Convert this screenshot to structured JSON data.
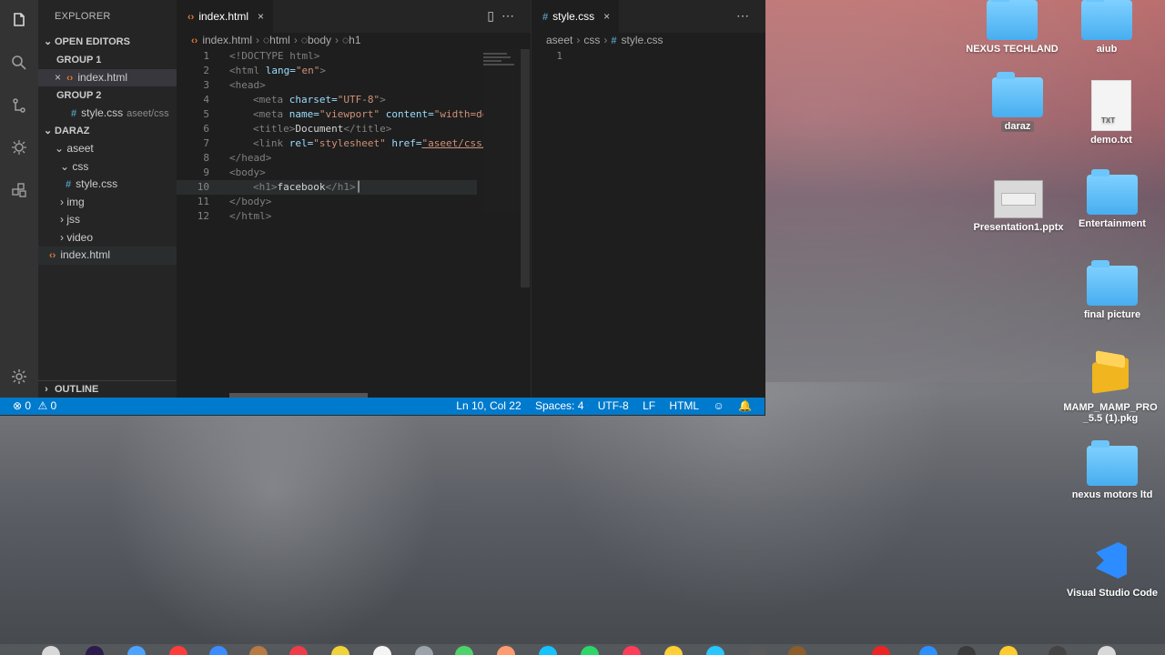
{
  "window": {
    "explorer_title": "EXPLORER",
    "open_editors": "OPEN EDITORS",
    "group_1": "GROUP 1",
    "group_2": "GROUP 2",
    "open_file_1": "index.html",
    "open_file_2": "style.css",
    "open_file_2_path": "aseet/css",
    "workspace": "DARAZ",
    "tree": {
      "aseet": "aseet",
      "css": "css",
      "style": "style.css",
      "img": "img",
      "jss": "jss",
      "video": "video",
      "index": "index.html"
    },
    "outline": "OUTLINE"
  },
  "editor_left": {
    "tab": "index.html",
    "breadcrumb": [
      "index.html",
      "html",
      "body",
      "h1"
    ],
    "line_numbers": [
      "1",
      "2",
      "3",
      "4",
      "5",
      "6",
      "7",
      "8",
      "9",
      "10",
      "11",
      "12"
    ],
    "lines": {
      "l1": "<!DOCTYPE html>",
      "l2_open": "<html",
      "l2_attr": " lang=",
      "l2_val": "\"en\"",
      "l2_close": ">",
      "l3": "<head>",
      "l4_open": "<meta",
      "l4_attr": " charset=",
      "l4_val": "\"UTF-8\"",
      "l4_close": ">",
      "l5_open": "<meta",
      "l5_attr1": " name=",
      "l5_val1": "\"viewport\"",
      "l5_attr2": " content=",
      "l5_val2": "\"width=de",
      "l6_open": "<title>",
      "l6_text": "Document",
      "l6_close": "</title>",
      "l7_open": "<link",
      "l7_attr1": " rel=",
      "l7_val1": "\"stylesheet\"",
      "l7_attr2": " href=",
      "l7_val2": "\"aseet/css/",
      "l8": "</head>",
      "l9": "<body>",
      "l10_open": "<h1>",
      "l10_text": "facebook",
      "l10_close": "</h1>",
      "l11": "</body>",
      "l12": "</html>"
    }
  },
  "editor_right": {
    "tab": "style.css",
    "breadcrumb": [
      "aseet",
      "css",
      "style.css"
    ],
    "line_1": "1"
  },
  "status": {
    "errors": "0",
    "warnings": "0",
    "position": "Ln 10, Col 22",
    "spaces": "Spaces: 4",
    "encoding": "UTF-8",
    "eol": "LF",
    "language": "HTML"
  },
  "desktop": {
    "nexus_techland": "NEXUS TECHLAND",
    "aiub": "aiub",
    "daraz": "daraz",
    "demo": "demo.txt",
    "presentation": "Presentation1.pptx",
    "entertainment": "Entertainment",
    "final_picture": "final picture",
    "mamp": "MAMP_MAMP_PRO\n_5.5 (1).pkg",
    "nexus_motors": "nexus motors ltd",
    "vscode": "Visual Studio Code"
  }
}
